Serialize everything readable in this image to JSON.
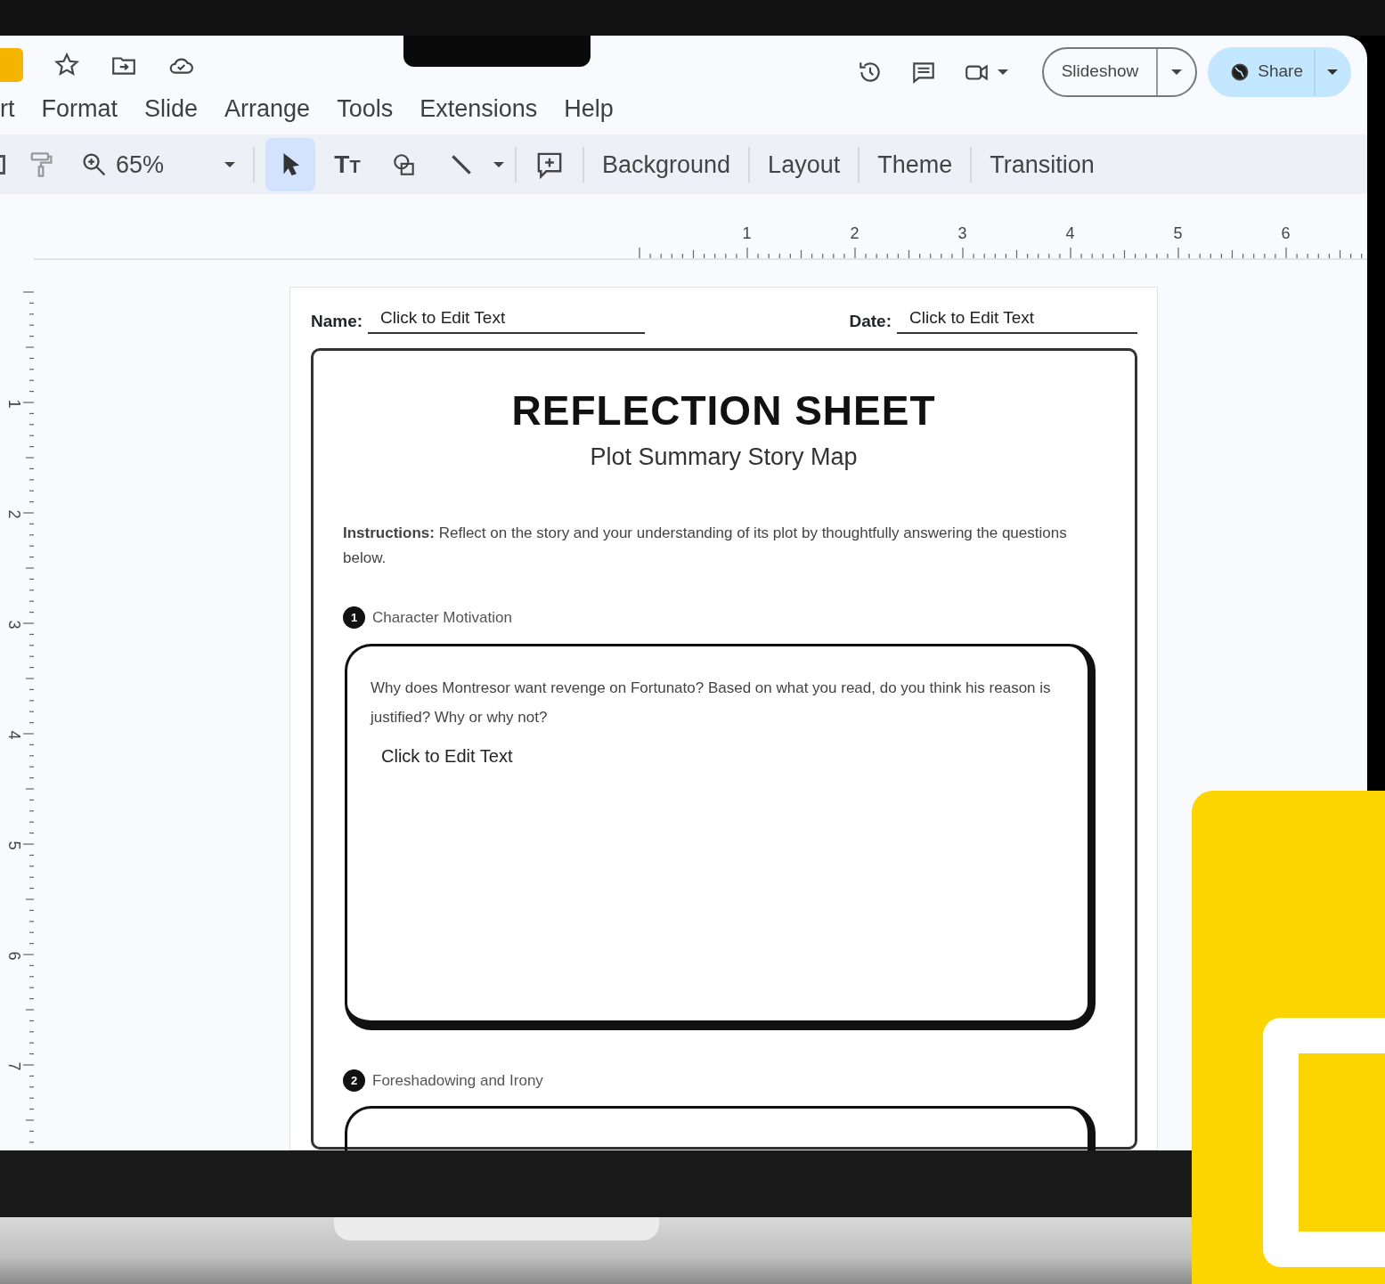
{
  "top_icons": [
    {
      "kind": "star"
    },
    {
      "kind": "folder"
    },
    {
      "kind": "cloud"
    }
  ],
  "menu": [
    {
      "label": "rt"
    },
    {
      "label": "Format"
    },
    {
      "label": "Slide"
    },
    {
      "label": "Arrange"
    },
    {
      "label": "Tools"
    },
    {
      "label": "Extensions"
    },
    {
      "label": "Help"
    }
  ],
  "slideshow_button": "Slideshow",
  "share_button": "Share",
  "zoom": "65%",
  "tools": [
    {
      "kind": "select",
      "selected": true
    },
    {
      "kind": "text",
      "selected": false,
      "label": "Tt"
    },
    {
      "kind": "shape",
      "selected": false
    },
    {
      "kind": "line",
      "selected": false
    }
  ],
  "toolbar_buttons": [
    "Background",
    "Layout",
    "Theme",
    "Transition"
  ],
  "ruler": {
    "horizontal": [
      "1",
      "2",
      "3",
      "4",
      "5",
      "6"
    ],
    "vertical": [
      "1",
      "2",
      "3",
      "4",
      "5",
      "6",
      "7"
    ]
  },
  "slide": {
    "name_label": "Name:",
    "name_value": "Click to Edit Text",
    "date_label": "Date:",
    "date_value": "Click to Edit Text",
    "title": "REFLECTION SHEET",
    "subtitle": "Plot Summary Story Map",
    "instructions": "**Instructions:** Reflect on the story and your understanding of its plot by thoughtfully answering the questions below.",
    "sections": [
      {
        "number": "1",
        "heading": "Character Motivation",
        "question": "Why does Montresor want revenge on Fortunato? Based on what you read, do you think his reason is justified? Why or why not?",
        "answer": "Click to Edit Text"
      },
      {
        "number": "2",
        "heading": "Foreshadowing and Irony"
      }
    ]
  }
}
